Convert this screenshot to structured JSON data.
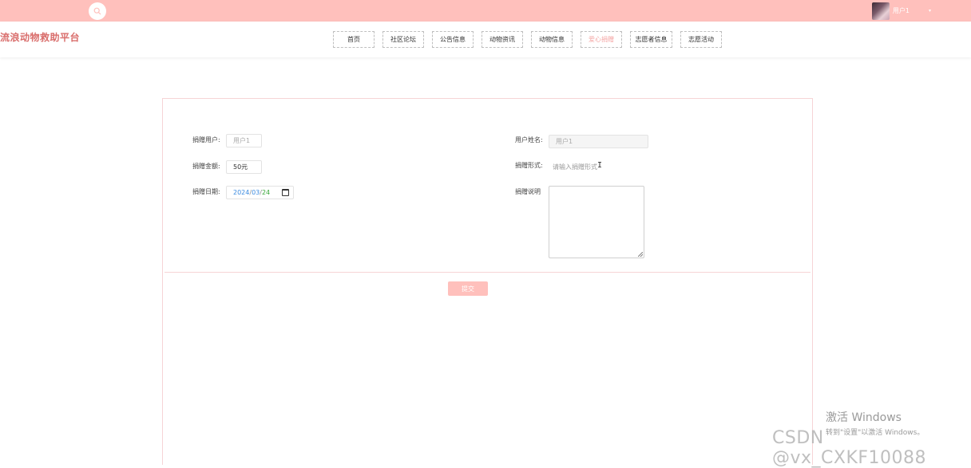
{
  "topbar": {
    "user_name": "用户1",
    "caret": "▾",
    "icons": {
      "search": "search-icon",
      "avatar": "user-avatar"
    }
  },
  "header": {
    "site_title": "流浪动物救助平台",
    "nav": [
      {
        "label": "首页",
        "active": false
      },
      {
        "label": "社区论坛",
        "active": false
      },
      {
        "label": "公告信息",
        "active": false
      },
      {
        "label": "动物资讯",
        "active": false
      },
      {
        "label": "动物信息",
        "active": false
      },
      {
        "label": "爱心捐赠",
        "active": true
      },
      {
        "label": "志愿者信息",
        "active": false
      },
      {
        "label": "志愿活动",
        "active": false
      }
    ]
  },
  "form": {
    "donor_user_label": "捐赠用户:",
    "donor_user_value": "用户1",
    "user_name_label": "用户姓名:",
    "user_name_value": "用户1",
    "amount_label": "捐赠金额:",
    "amount_value": "50元",
    "form_label": "捐赠形式:",
    "form_placeholder": "请输入捐赠形式",
    "date_label": "捐赠日期:",
    "date_year": "2024",
    "date_month": "03",
    "date_day": "24",
    "date_sep": "/",
    "desc_label": "捐赠说明",
    "submit_label": "提交"
  },
  "colors": {
    "accent": "#ffc0bc",
    "title_red": "#d96d6b",
    "active_nav": "#f4a6a4"
  },
  "watermark": {
    "win_title": "激活 Windows",
    "win_sub": "转到\"设置\"以激活 Windows。",
    "csdn": "CSDN @vx_CXKF10088"
  }
}
